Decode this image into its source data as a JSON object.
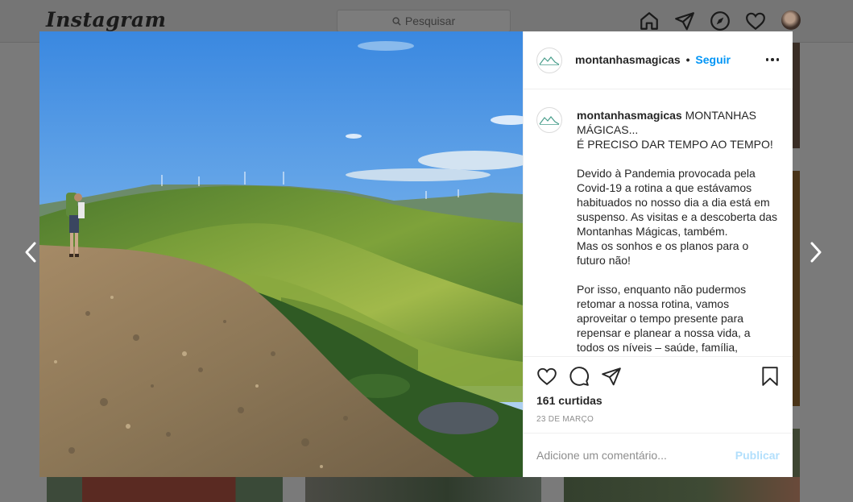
{
  "app": {
    "logo_text": "Instagram",
    "search_placeholder": "Pesquisar",
    "nav_icons": [
      "home-icon",
      "direct-icon",
      "explore-icon",
      "activity-heart-icon",
      "profile-avatar"
    ]
  },
  "post": {
    "username": "montanhasmagicas",
    "separator": "•",
    "follow_label": "Seguir",
    "caption_user": "montanhasmagicas",
    "caption_text": " MONTANHAS MÁGICAS...\nÉ PRECISO DAR TEMPO AO TEMPO!\n\nDevido à Pandemia provocada pela Covid-19 a rotina a que estávamos habituados no nosso dia a dia está em suspenso. As visitas e a descoberta das Montanhas Mágicas, também.\nMas os sonhos e os planos para o futuro não!\n\nPor isso, enquanto não pudermos retomar a nossa rotina, vamos aproveitar o tempo presente para repensar e planear a nossa vida, a todos os níveis – saúde, família,",
    "likes_text": "161 curtidas",
    "date_text": "23 DE MARÇO",
    "comment_placeholder": "Adicione um comentário...",
    "publish_label": "Publicar"
  },
  "colors": {
    "link_blue": "#0095f6",
    "publish_disabled": "#b2dffc",
    "text_primary": "#262626",
    "text_secondary": "#8e8e8e"
  }
}
